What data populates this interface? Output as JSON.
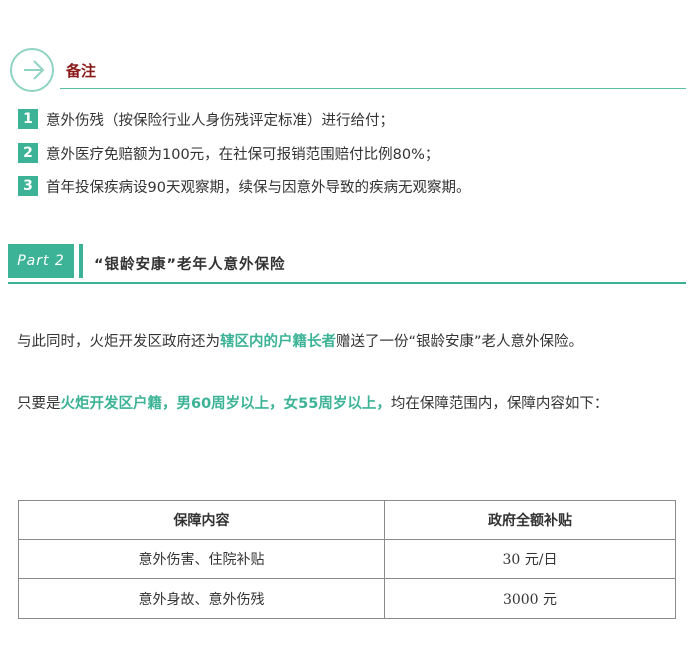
{
  "note": {
    "title": "备注",
    "items": [
      {
        "num": "1",
        "text": "意外伤残（按保险行业人身伤残评定标准）进行给付；"
      },
      {
        "num": "2",
        "text": "意外医疗免赔额为100元，在社保可报销范围赔付比例80%；"
      },
      {
        "num": "3",
        "text": "首年投保疾病设90天观察期，续保与因意外导致的疾病无观察期。"
      }
    ]
  },
  "section": {
    "part_label": "Part 2",
    "title": "“银龄安康”老年人意外保险"
  },
  "paragraphs": {
    "p1_before": "与此同时，火炬开发区政府还为",
    "p1_highlight": "辖区内的户籍长者",
    "p1_after": "赠送了一份“银龄安康”老人意外保险。",
    "p2_before": "只要是",
    "p2_highlight": "火炬开发区户籍，男60周岁以上，女55周岁以上，",
    "p2_after": "均在保障范围内，保障内容如下："
  },
  "table": {
    "headers": [
      "保障内容",
      "政府全额补贴"
    ],
    "rows": [
      [
        "意外伤害、住院补贴",
        "30 元/日"
      ],
      [
        "意外身故、意外伤残",
        "3000 元"
      ]
    ]
  },
  "colors": {
    "accent": "#3cb396",
    "note_title": "#8b1a1a",
    "border": "#8a8a8a"
  },
  "icons": {
    "note_header": "arrow-circle-icon"
  }
}
